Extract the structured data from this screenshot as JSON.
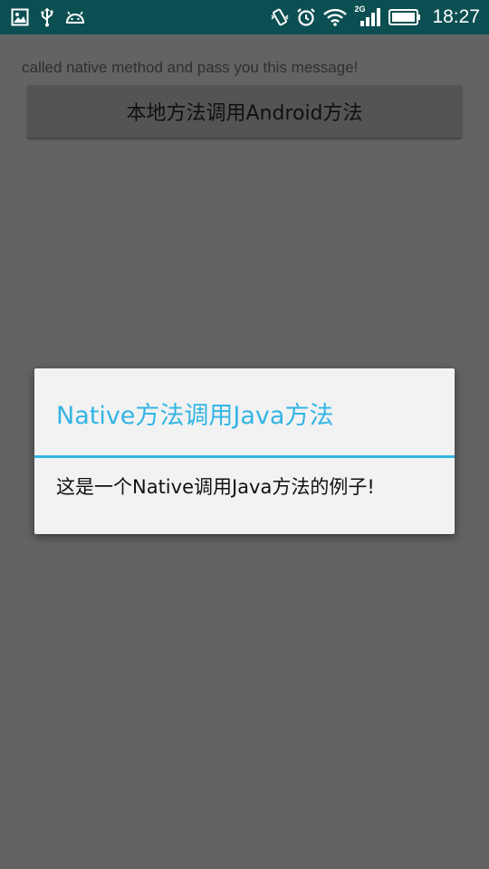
{
  "status_bar": {
    "time": "18:27",
    "network_type": "2G",
    "icons_left": [
      "image-icon",
      "usb-icon",
      "android-icon"
    ],
    "icons_right": [
      "vibrate-icon",
      "alarm-icon",
      "wifi-icon",
      "signal-icon",
      "battery-icon"
    ],
    "color": "#0c4f52"
  },
  "page": {
    "message": "called native method and pass you this message!",
    "button_label": "本地方法调用Android方法"
  },
  "dialog": {
    "title": "Native方法调用Java方法",
    "message": "这是一个Native调用Java方法的例子!",
    "accent_color": "#33b5e5"
  }
}
